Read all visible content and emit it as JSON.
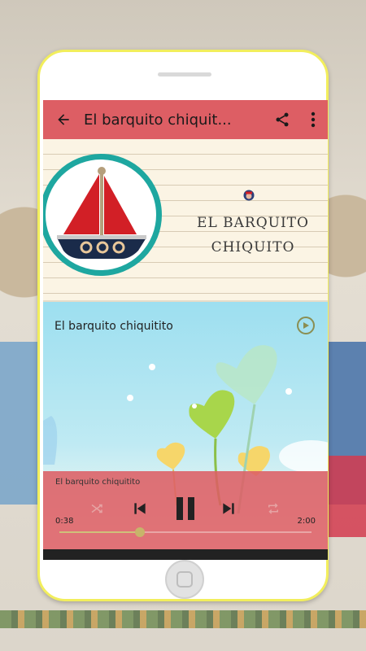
{
  "appbar": {
    "title": "El barquito chiquit...",
    "back_icon": "arrow-left-icon",
    "share_icon": "share-icon",
    "menu_icon": "more-vert-icon"
  },
  "header_art": {
    "title_line1": "EL BARQUITO",
    "title_line2": "CHIQUITO"
  },
  "player": {
    "track_title": "El barquito chiquitito",
    "controls_title": "El barquito chiquitito",
    "elapsed": "0:38",
    "duration": "2:00",
    "progress": 0.32
  },
  "colors": {
    "accent": "#dd5e64",
    "frame": "#f2ee5c",
    "teal": "#1ea7a0"
  }
}
